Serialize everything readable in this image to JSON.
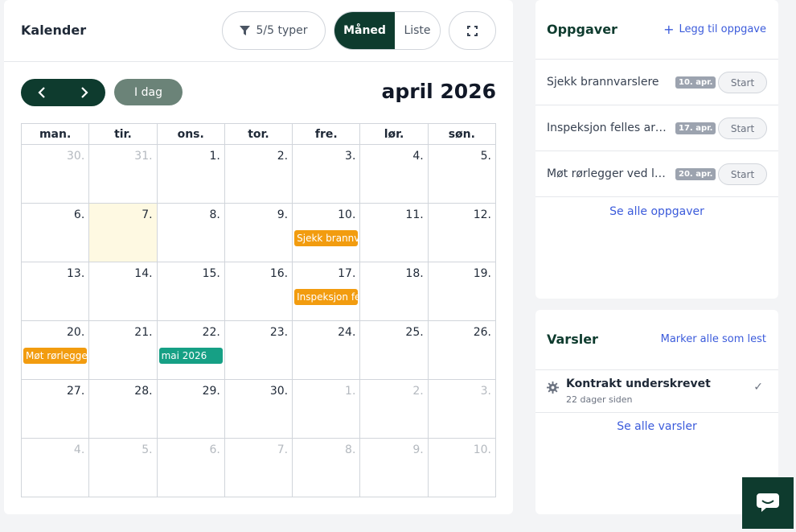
{
  "calendar": {
    "title": "Kalender",
    "filter_label": "5/5 typer",
    "view_month": "Måned",
    "view_list": "Liste",
    "today_label": "I dag",
    "month_label": "april 2026",
    "weekdays": [
      "man.",
      "tir.",
      "ons.",
      "tor.",
      "fre.",
      "lør.",
      "søn."
    ],
    "weeks": [
      [
        {
          "d": "30.",
          "other": true
        },
        {
          "d": "31.",
          "other": true
        },
        {
          "d": "1."
        },
        {
          "d": "2."
        },
        {
          "d": "3."
        },
        {
          "d": "4."
        },
        {
          "d": "5."
        }
      ],
      [
        {
          "d": "6."
        },
        {
          "d": "7.",
          "today": true
        },
        {
          "d": "8."
        },
        {
          "d": "9."
        },
        {
          "d": "10.",
          "event": "Sjekk brannvarslere",
          "color": "#f29c0f"
        },
        {
          "d": "11."
        },
        {
          "d": "12."
        }
      ],
      [
        {
          "d": "13."
        },
        {
          "d": "14."
        },
        {
          "d": "15."
        },
        {
          "d": "16."
        },
        {
          "d": "17.",
          "event": "Inspeksjon felles areal",
          "color": "#f29c0f"
        },
        {
          "d": "18."
        },
        {
          "d": "19."
        }
      ],
      [
        {
          "d": "20.",
          "event": "Møt rørlegger ved lekkasje",
          "color": "#f29c0f"
        },
        {
          "d": "21."
        },
        {
          "d": "22.",
          "event": "mai 2026",
          "color": "#16a085"
        },
        {
          "d": "23."
        },
        {
          "d": "24."
        },
        {
          "d": "25."
        },
        {
          "d": "26."
        }
      ],
      [
        {
          "d": "27."
        },
        {
          "d": "28."
        },
        {
          "d": "29."
        },
        {
          "d": "30."
        },
        {
          "d": "1.",
          "other": true
        },
        {
          "d": "2.",
          "other": true
        },
        {
          "d": "3.",
          "other": true
        }
      ],
      [
        {
          "d": "4.",
          "other": true
        },
        {
          "d": "5.",
          "other": true
        },
        {
          "d": "6.",
          "other": true
        },
        {
          "d": "7.",
          "other": true
        },
        {
          "d": "8.",
          "other": true
        },
        {
          "d": "9.",
          "other": true
        },
        {
          "d": "10.",
          "other": true
        }
      ]
    ]
  },
  "tasks": {
    "title": "Oppgaver",
    "add_label": "Legg til oppgave",
    "items": [
      {
        "name": "Sjekk brannvarslere",
        "date": "10. apr.",
        "action": "Start"
      },
      {
        "name": "Inspeksjon felles areal",
        "date": "17. apr.",
        "action": "Start"
      },
      {
        "name": "Møt rørlegger ved lekkasje",
        "date": "20. apr.",
        "action": "Start"
      }
    ],
    "see_all": "Se alle oppgaver"
  },
  "alerts": {
    "title": "Varsler",
    "mark_read": "Marker alle som lest",
    "item": {
      "title": "Kontrakt underskrevet",
      "time": "22 dager siden"
    },
    "see_all": "Se alle varsler"
  },
  "colors": {
    "brand": "#0e3b2e",
    "link": "#3b5bdb",
    "event_orange": "#f29c0f",
    "event_green": "#16a085"
  }
}
